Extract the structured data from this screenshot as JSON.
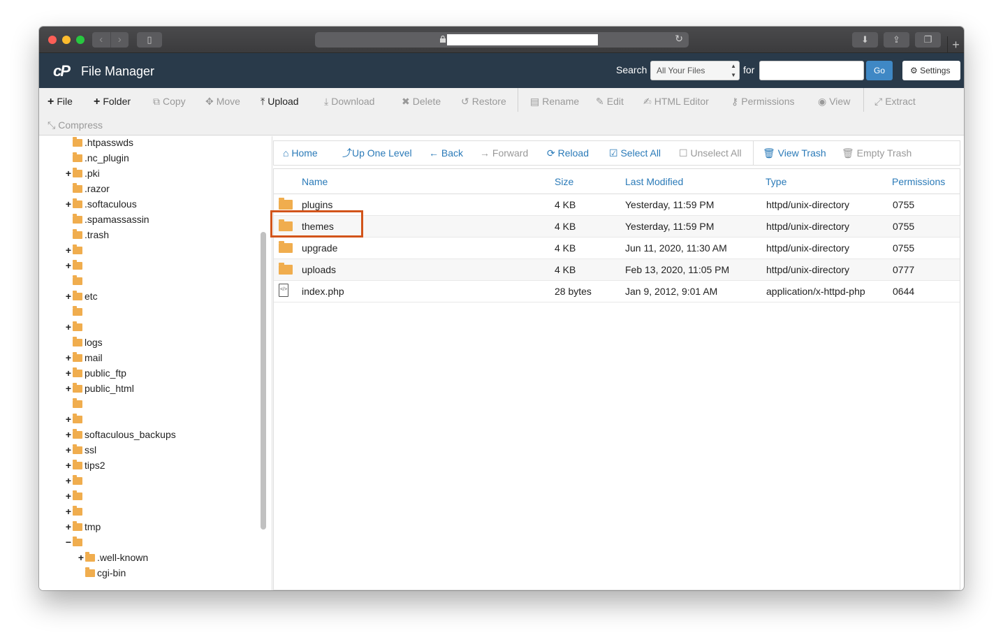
{
  "app": {
    "title": "File Manager",
    "logo": "cP"
  },
  "search": {
    "label": "Search",
    "scope": "All Your Files",
    "for_label": "for",
    "query": "",
    "go_label": "Go",
    "settings_label": "Settings"
  },
  "toolbar": {
    "file": "File",
    "folder": "Folder",
    "copy": "Copy",
    "move": "Move",
    "upload": "Upload",
    "download": "Download",
    "delete": "Delete",
    "restore": "Restore",
    "rename": "Rename",
    "edit": "Edit",
    "html_editor": "HTML Editor",
    "permissions": "Permissions",
    "view": "View",
    "extract": "Extract",
    "compress": "Compress"
  },
  "tree": {
    "items": [
      {
        "label": ".htpasswds",
        "toggle": ""
      },
      {
        "label": ".nc_plugin",
        "toggle": ""
      },
      {
        "label": ".pki",
        "toggle": "+"
      },
      {
        "label": ".razor",
        "toggle": ""
      },
      {
        "label": ".softaculous",
        "toggle": "+"
      },
      {
        "label": ".spamassassin",
        "toggle": ""
      },
      {
        "label": ".trash",
        "toggle": ""
      },
      {
        "label": "",
        "toggle": "+"
      },
      {
        "label": "",
        "toggle": "+"
      },
      {
        "label": "",
        "toggle": ""
      },
      {
        "label": "etc",
        "toggle": "+"
      },
      {
        "label": "",
        "toggle": ""
      },
      {
        "label": "",
        "toggle": "+"
      },
      {
        "label": "logs",
        "toggle": ""
      },
      {
        "label": "mail",
        "toggle": "+"
      },
      {
        "label": "public_ftp",
        "toggle": "+"
      },
      {
        "label": "public_html",
        "toggle": "+"
      },
      {
        "label": "",
        "toggle": ""
      },
      {
        "label": "",
        "toggle": "+"
      },
      {
        "label": "softaculous_backups",
        "toggle": "+"
      },
      {
        "label": "ssl",
        "toggle": "+"
      },
      {
        "label": "tips2",
        "toggle": "+"
      },
      {
        "label": "",
        "toggle": "+"
      },
      {
        "label": "",
        "toggle": "+"
      },
      {
        "label": "",
        "toggle": "+"
      },
      {
        "label": "tmp",
        "toggle": "+"
      },
      {
        "label": "",
        "toggle": "−"
      },
      {
        "label": ".well-known",
        "toggle": "+"
      },
      {
        "label": "cgi-bin",
        "toggle": ""
      }
    ]
  },
  "nav": {
    "home": "Home",
    "up": "Up One Level",
    "back": "Back",
    "forward": "Forward",
    "reload": "Reload",
    "select_all": "Select All",
    "unselect_all": "Unselect All",
    "view_trash": "View Trash",
    "empty_trash": "Empty Trash"
  },
  "table": {
    "headers": {
      "name": "Name",
      "size": "Size",
      "modified": "Last Modified",
      "type": "Type",
      "permissions": "Permissions"
    },
    "rows": [
      {
        "name": "plugins",
        "size": "4 KB",
        "modified": "Yesterday, 11:59 PM",
        "type": "httpd/unix-directory",
        "perms": "0755",
        "icon": "folder"
      },
      {
        "name": "themes",
        "size": "4 KB",
        "modified": "Yesterday, 11:59 PM",
        "type": "httpd/unix-directory",
        "perms": "0755",
        "icon": "folder"
      },
      {
        "name": "upgrade",
        "size": "4 KB",
        "modified": "Jun 11, 2020, 11:30 AM",
        "type": "httpd/unix-directory",
        "perms": "0755",
        "icon": "folder"
      },
      {
        "name": "uploads",
        "size": "4 KB",
        "modified": "Feb 13, 2020, 11:05 PM",
        "type": "httpd/unix-directory",
        "perms": "0777",
        "icon": "folder"
      },
      {
        "name": "index.php",
        "size": "28 bytes",
        "modified": "Jan 9, 2012, 9:01 AM",
        "type": "application/x-httpd-php",
        "perms": "0644",
        "icon": "php-file"
      }
    ]
  },
  "colors": {
    "header_bg": "#293a4a",
    "link": "#2a7ab8",
    "folder": "#f0ad4e",
    "highlight": "#d2541a",
    "go_button": "#3f88c5"
  }
}
